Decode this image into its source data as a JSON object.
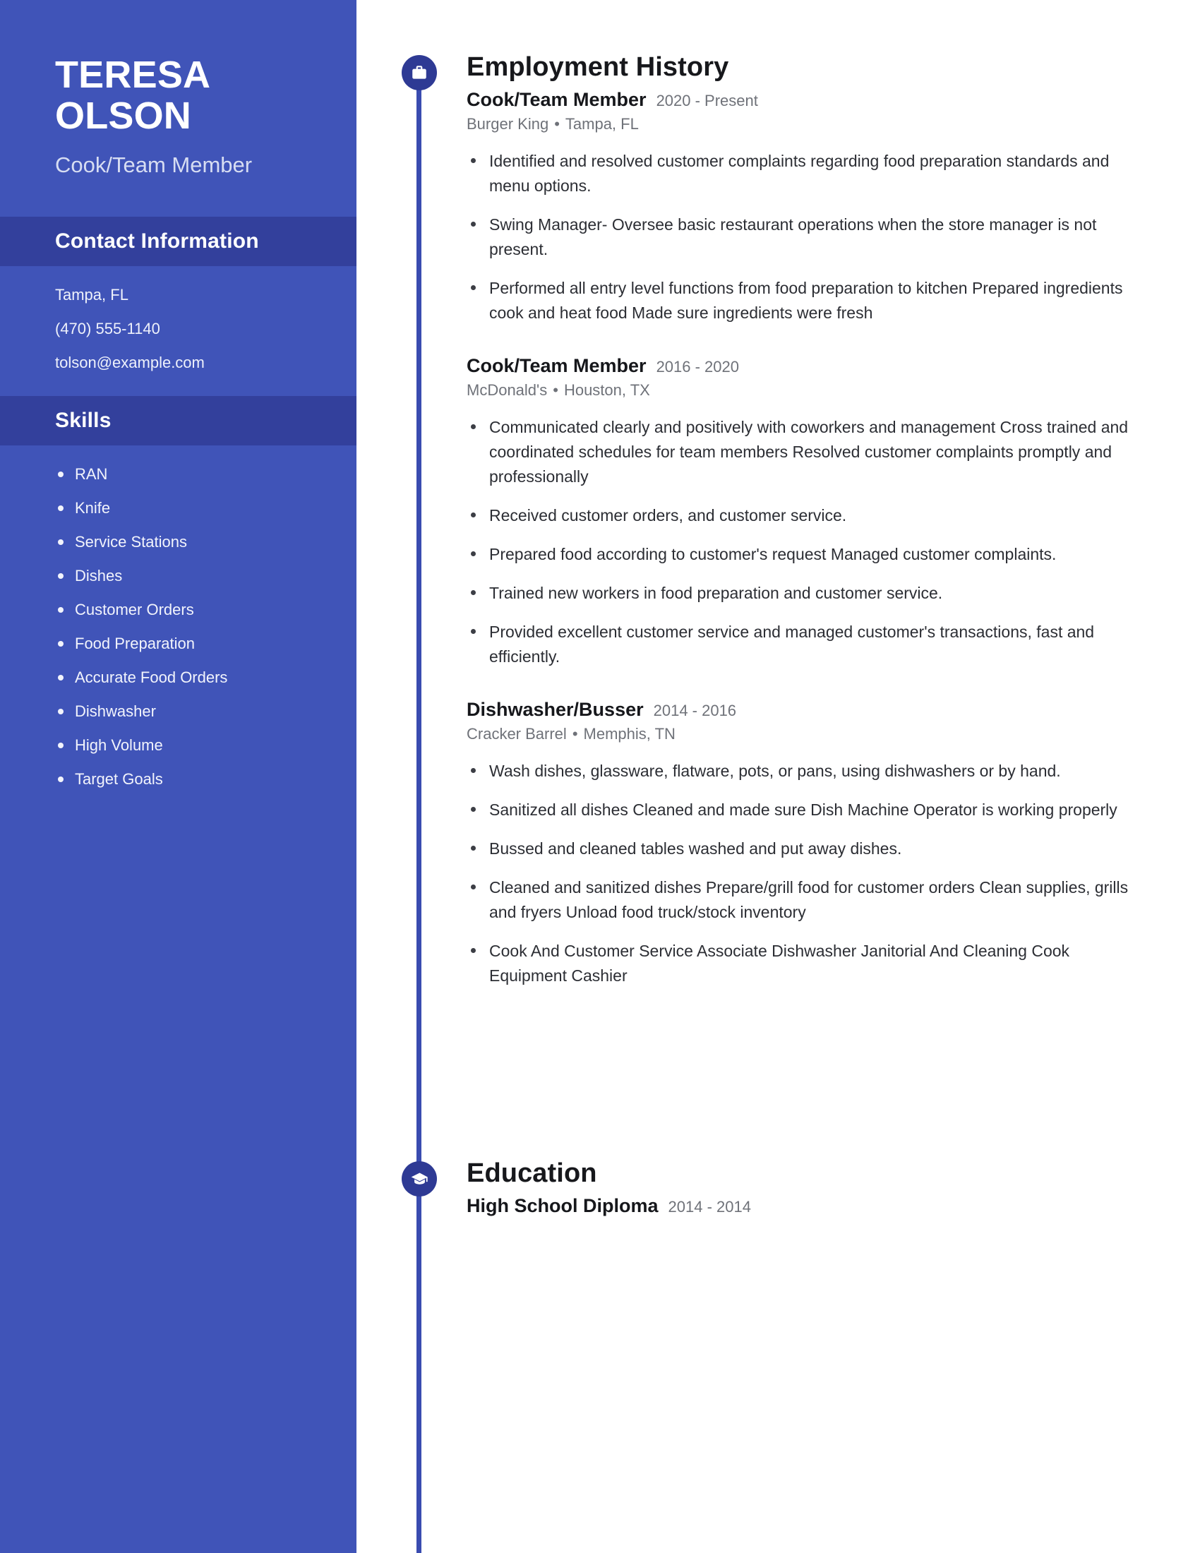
{
  "sidebar": {
    "name_first": "TERESA",
    "name_last": "OLSON",
    "job_title": "Cook/Team Member",
    "contact": {
      "heading": "Contact Information",
      "location": "Tampa, FL",
      "phone": "(470) 555-1140",
      "email": "tolson@example.com"
    },
    "skills": {
      "heading": "Skills",
      "items": [
        "RAN",
        "Knife",
        "Service Stations",
        "Dishes",
        "Customer Orders",
        "Food Preparation",
        "Accurate Food Orders",
        "Dishwasher",
        "High Volume",
        "Target Goals"
      ]
    }
  },
  "main": {
    "employment": {
      "heading": "Employment History",
      "icon": "briefcase-icon",
      "entries": [
        {
          "role": "Cook/Team Member",
          "dates": "2020 - Present",
          "company": "Burger King",
          "location": "Tampa, FL",
          "bullets": [
            "Identified and resolved customer complaints regarding food preparation standards and menu options.",
            "Swing Manager- Oversee basic restaurant operations when the store manager is not present.",
            "Performed all entry level functions from food preparation to kitchen Prepared ingredients cook and heat food Made sure ingredients were fresh"
          ]
        },
        {
          "role": "Cook/Team Member",
          "dates": "2016 - 2020",
          "company": "McDonald's",
          "location": "Houston, TX",
          "bullets": [
            "Communicated clearly and positively with coworkers and management Cross trained and coordinated schedules for team members Resolved customer complaints promptly and professionally",
            "Received customer orders, and customer service.",
            "Prepared food according to customer's request Managed customer complaints.",
            "Trained new workers in food preparation and customer service.",
            "Provided excellent customer service and managed customer's transactions, fast and efficiently."
          ]
        },
        {
          "role": "Dishwasher/Busser",
          "dates": "2014 - 2016",
          "company": "Cracker Barrel",
          "location": "Memphis, TN",
          "bullets": [
            "Wash dishes, glassware, flatware, pots, or pans, using dishwashers or by hand.",
            "Sanitized all dishes Cleaned and made sure Dish Machine Operator is working properly",
            "Bussed and cleaned tables washed and put away dishes.",
            "Cleaned and sanitized dishes Prepare/grill food for customer orders Clean supplies, grills and fryers Unload food truck/stock inventory",
            "Cook And Customer Service Associate Dishwasher Janitorial And Cleaning Cook Equipment Cashier"
          ]
        }
      ]
    },
    "education": {
      "heading": "Education",
      "icon": "graduation-cap-icon",
      "entries": [
        {
          "degree": "High School Diploma",
          "dates": "2014 - 2014"
        }
      ]
    }
  },
  "theme": {
    "sidebar_bg": "#4054b8",
    "sidebar_banner_bg": "#33409c",
    "icon_circle": "#2e3a94",
    "rail": "#3a4cb0",
    "body_text": "#2c2e34",
    "muted_text": "#6f7279"
  },
  "separators": {
    "bullet_dot": "•"
  }
}
